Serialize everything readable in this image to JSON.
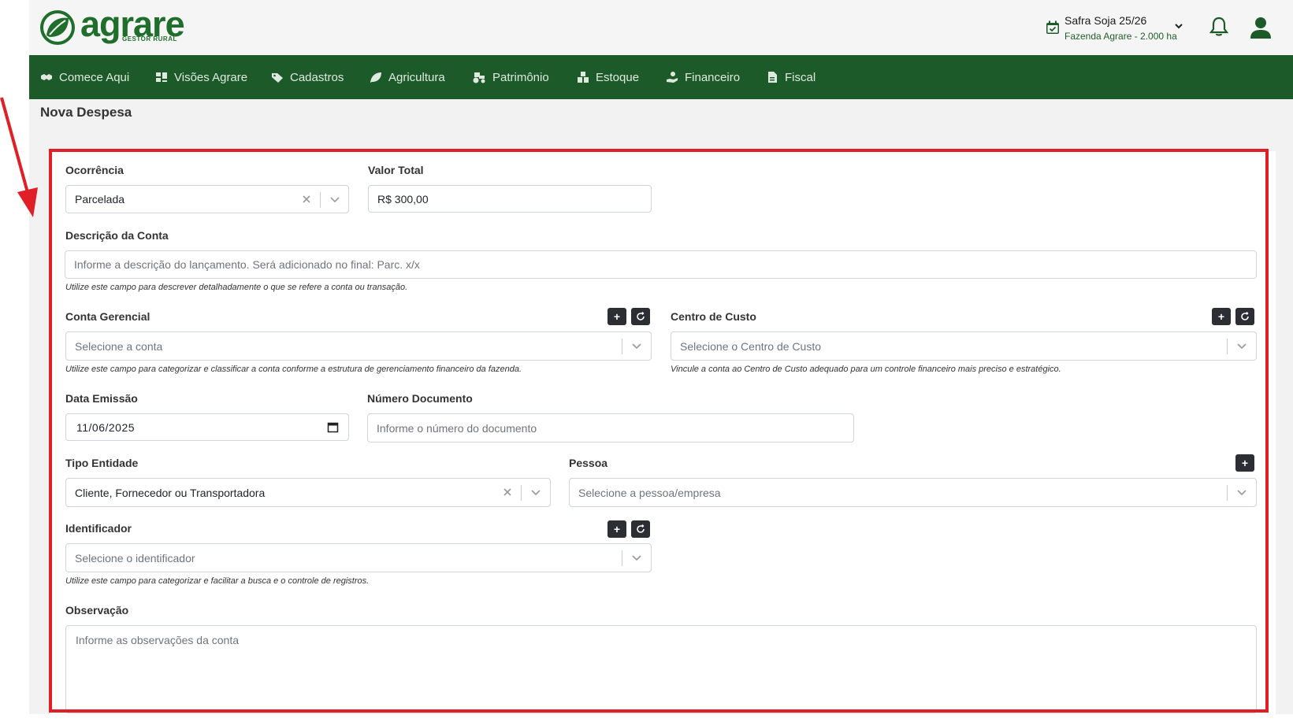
{
  "brand": {
    "name": "agrare",
    "tagline": "GESTOR RURAL"
  },
  "season": {
    "title": "Safra Soja 25/26",
    "farm": "Fazenda Agrare - 2.000 ha"
  },
  "nav": {
    "items": [
      {
        "label": "Comece Aqui",
        "icon": "handshake-icon"
      },
      {
        "label": "Visões Agrare",
        "icon": "dashboard-icon"
      },
      {
        "label": "Cadastros",
        "icon": "tag-icon"
      },
      {
        "label": "Agricultura",
        "icon": "leaf-icon"
      },
      {
        "label": "Patrimônio",
        "icon": "tractor-icon"
      },
      {
        "label": "Estoque",
        "icon": "boxes-icon"
      },
      {
        "label": "Financeiro",
        "icon": "money-hand-icon"
      },
      {
        "label": "Fiscal",
        "icon": "file-icon"
      }
    ]
  },
  "page": {
    "title": "Nova Despesa"
  },
  "form": {
    "ocorrencia": {
      "label": "Ocorrência",
      "value": "Parcelada"
    },
    "valor_total": {
      "label": "Valor Total",
      "value": "R$ 300,00"
    },
    "descricao": {
      "label": "Descrição da Conta",
      "placeholder": "Informe a descrição do lançamento. Será adicionado no final: Parc. x/x",
      "hint": "Utilize este campo para descrever detalhadamente o que se refere a conta ou transação."
    },
    "conta_gerencial": {
      "label": "Conta Gerencial",
      "placeholder": "Selecione a conta",
      "hint": "Utilize este campo para categorizar e classificar a conta conforme a estrutura de gerenciamento financeiro da fazenda."
    },
    "centro_custo": {
      "label": "Centro de Custo",
      "placeholder": "Selecione o Centro de Custo",
      "hint": "Vincule a conta ao Centro de Custo adequado para um controle financeiro mais preciso e estratégico."
    },
    "data_emissao": {
      "label": "Data Emissão",
      "value": "11/06/2025"
    },
    "numero_documento": {
      "label": "Número Documento",
      "placeholder": "Informe o número do documento"
    },
    "tipo_entidade": {
      "label": "Tipo Entidade",
      "value": "Cliente, Fornecedor ou Transportadora"
    },
    "pessoa": {
      "label": "Pessoa",
      "placeholder": "Selecione a pessoa/empresa"
    },
    "identificador": {
      "label": "Identificador",
      "placeholder": "Selecione o identificador",
      "hint": "Utilize este campo para categorizar e facilitar a busca e o controle de registros."
    },
    "observacao": {
      "label": "Observação",
      "placeholder": "Informe as observações da conta"
    }
  },
  "buttons": {
    "add": "+",
    "refresh": "↻"
  },
  "colors": {
    "brand_green": "#1f6e2b",
    "nav_bg": "#1d5a2a",
    "highlight_red": "#e01f26"
  }
}
